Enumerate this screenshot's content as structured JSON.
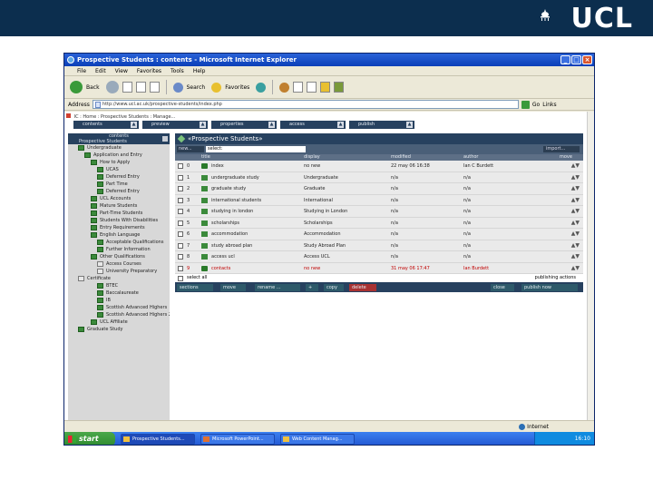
{
  "brand": {
    "logo_text": "UCL"
  },
  "window": {
    "title": "Prospective Students : contents - Microsoft Internet Explorer",
    "buttons": [
      "_",
      "□",
      "×"
    ]
  },
  "menu": [
    "File",
    "Edit",
    "View",
    "Favorites",
    "Tools",
    "Help"
  ],
  "toolbar": {
    "back": "Back",
    "search": "Search",
    "favorites": "Favorites"
  },
  "address": {
    "label": "Address",
    "url": "http://www.ucl.ac.uk/prospective-students/index.php",
    "go": "Go",
    "links": "Links"
  },
  "breadcrumb": "IC : Home : Prospective Students : Manage...",
  "tabs": [
    "contents",
    "preview",
    "properties",
    "access",
    "publish"
  ],
  "tree": {
    "header": "contents",
    "root": "Prospective Students",
    "nodes": [
      {
        "label": "Undergraduate",
        "indent": 1,
        "filled": true
      },
      {
        "label": "Application and Entry",
        "indent": 2,
        "filled": true
      },
      {
        "label": "How to Apply",
        "indent": 3,
        "filled": true
      },
      {
        "label": "UCAS",
        "indent": 4,
        "filled": true
      },
      {
        "label": "Deferred Entry",
        "indent": 4,
        "filled": true
      },
      {
        "label": "Part Time",
        "indent": 4,
        "filled": true
      },
      {
        "label": "Deferred Entry",
        "indent": 4,
        "filled": true
      },
      {
        "label": "UCL Accounts",
        "indent": 3,
        "filled": true
      },
      {
        "label": "Mature Students",
        "indent": 3,
        "filled": true
      },
      {
        "label": "Part-Time Students",
        "indent": 3,
        "filled": true
      },
      {
        "label": "Students With Disabilities",
        "indent": 3,
        "filled": true
      },
      {
        "label": "Entry Requirements",
        "indent": 3,
        "filled": true
      },
      {
        "label": "English Language",
        "indent": 3,
        "filled": true
      },
      {
        "label": "Acceptable Qualifications",
        "indent": 4,
        "filled": true
      },
      {
        "label": "Further Information",
        "indent": 4,
        "filled": true
      },
      {
        "label": "Other Qualifications",
        "indent": 3,
        "filled": true
      },
      {
        "label": "Access Courses",
        "indent": 4,
        "filled": false
      },
      {
        "label": "University Preparatory",
        "indent": 4,
        "filled": false
      },
      {
        "label": "Certificate",
        "indent": 1,
        "filled": false
      },
      {
        "label": "BTEC",
        "indent": 4,
        "filled": true
      },
      {
        "label": "Baccalaureate",
        "indent": 4,
        "filled": true
      },
      {
        "label": "IB",
        "indent": 4,
        "filled": true
      },
      {
        "label": "Scottish Advanced Highers",
        "indent": 4,
        "filled": true
      },
      {
        "label": "Scottish Advanced Highers 2",
        "indent": 4,
        "filled": true
      },
      {
        "label": "UCL Affiliate",
        "indent": 3,
        "filled": true
      },
      {
        "label": "Graduate Study",
        "indent": 1,
        "filled": true
      }
    ]
  },
  "panel": {
    "title": "«Prospective Students»",
    "new_label": "new...",
    "select_label": "select:",
    "import_label": "import...",
    "columns": [
      "",
      "",
      "title",
      "display",
      "modified",
      "author",
      "move"
    ],
    "rows": [
      {
        "num": "0",
        "title": "index",
        "display": "no new",
        "modified": "22 may 06 16:38",
        "author": "Ian C Burdett",
        "red": false
      },
      {
        "num": "1",
        "title": "undergraduate study",
        "display": "Undergraduate",
        "modified": "n/a",
        "author": "n/a",
        "red": false
      },
      {
        "num": "2",
        "title": "graduate study",
        "display": "Graduate",
        "modified": "n/a",
        "author": "n/a",
        "red": false
      },
      {
        "num": "3",
        "title": "international students",
        "display": "International",
        "modified": "n/a",
        "author": "n/a",
        "red": false
      },
      {
        "num": "4",
        "title": "studying in london",
        "display": "Studying in London",
        "modified": "n/a",
        "author": "n/a",
        "red": false
      },
      {
        "num": "5",
        "title": "scholarships",
        "display": "Scholarships",
        "modified": "n/a",
        "author": "n/a",
        "red": false
      },
      {
        "num": "6",
        "title": "accommodation",
        "display": "Accommodation",
        "modified": "n/a",
        "author": "n/a",
        "red": false
      },
      {
        "num": "7",
        "title": "study abroad plan",
        "display": "Study Abroad Plan",
        "modified": "n/a",
        "author": "n/a",
        "red": false
      },
      {
        "num": "8",
        "title": "access ucl",
        "display": "Access UCL",
        "modified": "n/a",
        "author": "n/a",
        "red": false
      },
      {
        "num": "9",
        "title": "contacts",
        "display": "no new",
        "modified": "31 may 06 17:47",
        "author": "Ian Burdett",
        "red": true
      }
    ],
    "select_all": "select all",
    "publishing_hint": "publishing actions",
    "actions": [
      "sections",
      "move",
      "rename ...",
      "+",
      "copy",
      "delete",
      "close",
      "publish now"
    ]
  },
  "statusbar": {
    "zone": "Internet"
  },
  "taskbar": {
    "start": "start",
    "tasks": [
      "Prospective Students...",
      "Microsoft PowerPoint...",
      "Web Content Manag..."
    ],
    "clock": "16:10"
  }
}
